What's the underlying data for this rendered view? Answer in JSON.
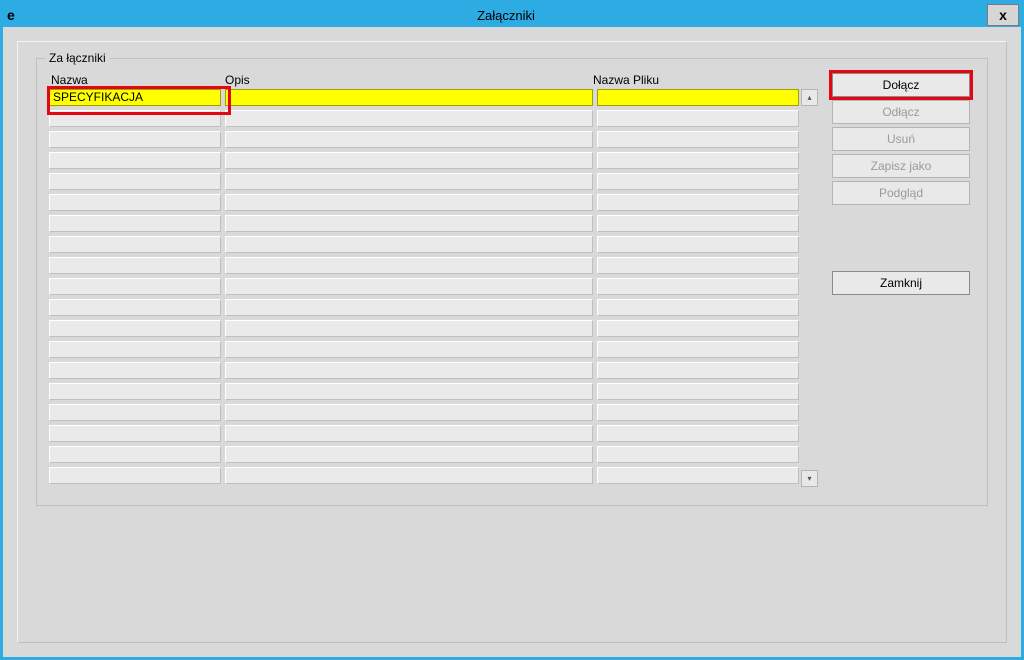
{
  "window": {
    "title": "Załączniki",
    "app_icon_letter": "e",
    "close_glyph": "x"
  },
  "fieldset": {
    "legend": "Za łączniki",
    "headers": {
      "name": "Nazwa",
      "description": "Opis",
      "filename": "Nazwa Pliku"
    }
  },
  "rows": [
    {
      "name": "SPECYFIKACJA",
      "description": "",
      "filename": "",
      "selected": true
    },
    {
      "name": "",
      "description": "",
      "filename": "",
      "selected": false
    },
    {
      "name": "",
      "description": "",
      "filename": "",
      "selected": false
    },
    {
      "name": "",
      "description": "",
      "filename": "",
      "selected": false
    },
    {
      "name": "",
      "description": "",
      "filename": "",
      "selected": false
    },
    {
      "name": "",
      "description": "",
      "filename": "",
      "selected": false
    },
    {
      "name": "",
      "description": "",
      "filename": "",
      "selected": false
    },
    {
      "name": "",
      "description": "",
      "filename": "",
      "selected": false
    },
    {
      "name": "",
      "description": "",
      "filename": "",
      "selected": false
    },
    {
      "name": "",
      "description": "",
      "filename": "",
      "selected": false
    },
    {
      "name": "",
      "description": "",
      "filename": "",
      "selected": false
    },
    {
      "name": "",
      "description": "",
      "filename": "",
      "selected": false
    },
    {
      "name": "",
      "description": "",
      "filename": "",
      "selected": false
    },
    {
      "name": "",
      "description": "",
      "filename": "",
      "selected": false
    },
    {
      "name": "",
      "description": "",
      "filename": "",
      "selected": false
    },
    {
      "name": "",
      "description": "",
      "filename": "",
      "selected": false
    },
    {
      "name": "",
      "description": "",
      "filename": "",
      "selected": false
    },
    {
      "name": "",
      "description": "",
      "filename": "",
      "selected": false
    },
    {
      "name": "",
      "description": "",
      "filename": "",
      "selected": false
    }
  ],
  "buttons": {
    "attach": "Dołącz",
    "detach": "Odłącz",
    "delete": "Usuń",
    "saveas": "Zapisz jako",
    "preview": "Podgląd",
    "close": "Zamknij"
  },
  "scroll": {
    "up": "▴",
    "down": "▾"
  }
}
